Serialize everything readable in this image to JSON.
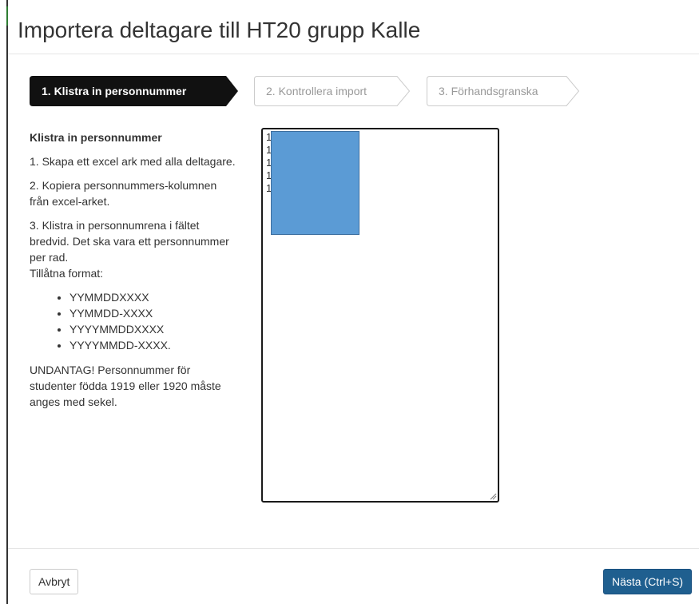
{
  "modal": {
    "title": "Importera deltagare till HT20 grupp Kalle"
  },
  "steps": [
    {
      "label": "1. Klistra in personnummer",
      "state": "active"
    },
    {
      "label": "2. Kontrollera import",
      "state": "inactive"
    },
    {
      "label": "3. Förhandsgranska",
      "state": "inactive"
    }
  ],
  "instructions": {
    "heading": "Klistra in personnummer",
    "step1": "1. Skapa ett excel ark med alla deltagare.",
    "step2": "2. Kopiera personnummers-kolumnen från excel-arket.",
    "step3_line1": "3. Klistra in personnumrena i fältet bredvid. Det ska vara ett personnummer per rad.",
    "step3_line2": "Tillåtna format:",
    "formats": [
      "YYMMDDXXXX",
      "YYMMDD-XXXX",
      "YYYYMMDDXXXX",
      "YYYYMMDD-XXXX."
    ],
    "exception": "UNDANTAG! Personnummer för studenter födda 1919 eller 1920 måste anges med sekel."
  },
  "textarea": {
    "visible_lines": [
      "1",
      "1",
      "1",
      "1",
      "1"
    ],
    "selection_color": "#5b9bd5"
  },
  "footer": {
    "cancel_label": "Avbryt",
    "next_label": "Nästa (Ctrl+S)"
  },
  "colors": {
    "active_step": "#111111",
    "primary_button": "#1f5f8f"
  }
}
